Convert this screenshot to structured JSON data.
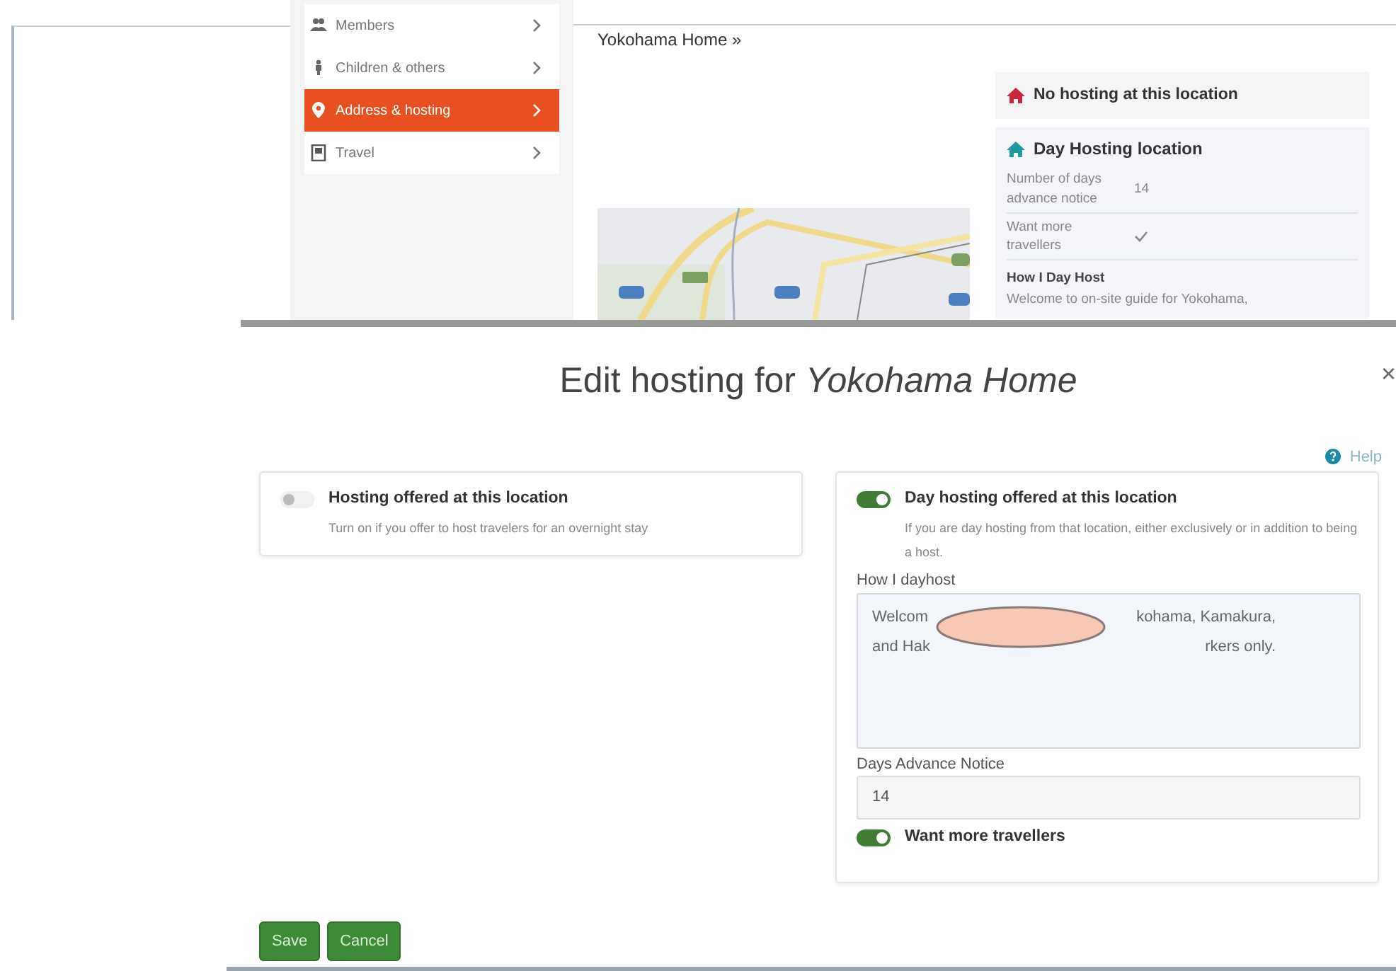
{
  "sidebar": {
    "items": [
      {
        "label": "Members",
        "selected": false
      },
      {
        "label": "Children & others",
        "selected": false
      },
      {
        "label": "Address & hosting",
        "selected": true
      },
      {
        "label": "Travel",
        "selected": false
      }
    ]
  },
  "location_title": "Yokohama Home »",
  "summary": {
    "no_hosting": "No hosting at this location",
    "day_hosting": {
      "title": "Day Hosting location",
      "rows": [
        {
          "label": "Number of days advance notice",
          "value": "14"
        },
        {
          "label": "Want more travellers",
          "checked": true
        }
      ],
      "how_title": "How I Day Host",
      "how_text": "Welcome to on-site guide for Yokohama,"
    }
  },
  "modal": {
    "title": "Edit hosting for *Yokohama Home*",
    "close": "×",
    "help": "Help",
    "hosting": {
      "label": "Hosting offered at this location",
      "on": false,
      "description": "Turn on if you offer to host travelers for an overnight stay"
    },
    "day_hosting": {
      "label": "Day hosting offered at this location",
      "on": true,
      "description": "If you are day hosting from that location, either exclusively or in addition to being a host.",
      "how_label": "How I dayhost",
      "how_lines": [
        [
          "Welcom",
          "kohama, Kamakura,"
        ],
        [
          "and Hak",
          "rkers only."
        ]
      ],
      "days_label": "Days Advance Notice",
      "days_value": "14",
      "want_more": {
        "label": "Want more travellers",
        "on": true
      }
    },
    "buttons": [
      "Save",
      "Cancel"
    ]
  }
}
